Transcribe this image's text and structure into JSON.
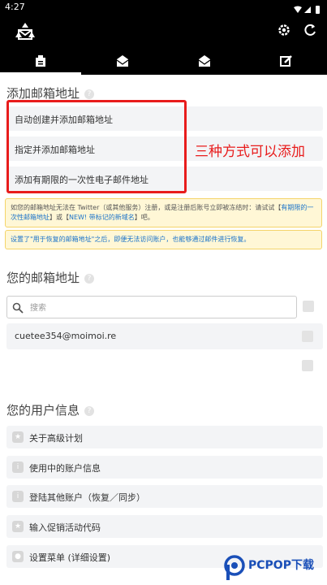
{
  "status_bar": {
    "time": "4:27"
  },
  "tabs": [
    {
      "name": "tab-mailbox-manage",
      "active": true
    },
    {
      "name": "tab-inbox",
      "active": false
    },
    {
      "name": "tab-open-mail",
      "active": false
    },
    {
      "name": "tab-compose",
      "active": false
    }
  ],
  "add_section": {
    "title": "添加邮箱地址",
    "options": [
      "自动创建并添加邮箱地址",
      "指定并添加邮箱地址",
      "添加有期限的一次性电子邮件地址"
    ],
    "annotation": "三种方式可以添加",
    "notice1_pre": "如您的邮箱地址无法在 Twitter（或其他服务）注册，或是注册后账号立即被冻结时：请试试【",
    "notice1_link1": "有期限的一次性邮箱地址",
    "notice1_mid": "】或【",
    "notice1_link2": "NEW! 带标记的新域名",
    "notice1_post": "】吧。",
    "notice2": "设置了\"用于恢复的邮箱地址\"之后，即便无法访问账户，也能够通过邮件进行恢复。"
  },
  "address_section": {
    "title": "您的邮箱地址",
    "search_placeholder": "搜索",
    "emails": [
      "cuetee354@moimoi.re"
    ]
  },
  "user_section": {
    "title": "您的用户信息",
    "items": [
      "关于高级计划",
      "使用中的账户信息",
      "登陆其他账户（恢复／同步）",
      "输入促销活动代码",
      "设置菜单 (详细设置)"
    ]
  },
  "watermark": {
    "brand": "PCPOP",
    "brand_cn": "下载"
  }
}
